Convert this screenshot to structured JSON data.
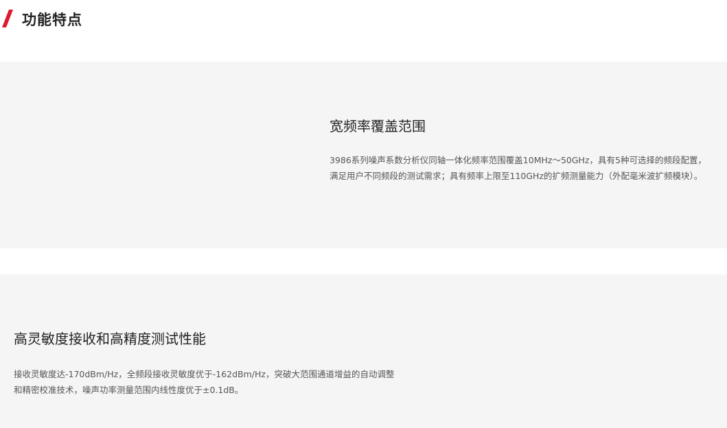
{
  "section": {
    "title": "功能特点",
    "accent_color": "#e0182d",
    "icon": "slash-accent-icon"
  },
  "features": [
    {
      "title": "宽频率覆盖范围",
      "description": "3986系列噪声系数分析仪同轴一体化频率范围覆盖10MHz～50GHz，具有5种可选择的频段配置，满足用户不同频段的测试需求；具有频率上限至110GHz的扩频测量能力（外配毫米波扩频模块）。"
    },
    {
      "title": "高灵敏度接收和高精度测试性能",
      "description": "接收灵敏度达-170dBm/Hz，全频段接收灵敏度优于-162dBm/Hz，突破大范围通道增益的自动调整和精密校准技术，噪声功率测量范围内线性度优于±0.1dB。"
    }
  ],
  "colors": {
    "card_background": "#f5f5f5",
    "title_text": "#222222",
    "body_text": "#555555"
  }
}
